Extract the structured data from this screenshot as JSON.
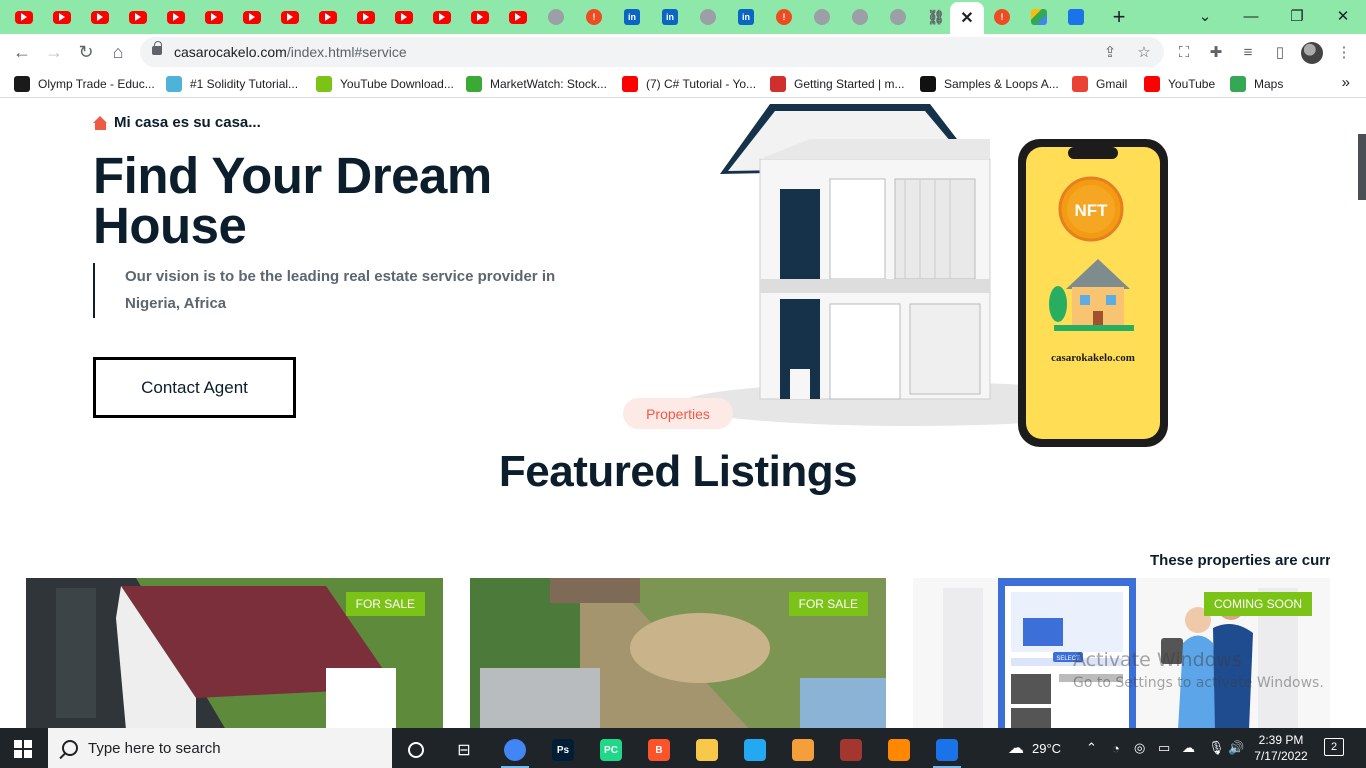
{
  "browser": {
    "tabs": [
      {
        "icon": "youtube-icon",
        "kind": "yt"
      },
      {
        "icon": "youtube-icon",
        "kind": "yt"
      },
      {
        "icon": "youtube-icon",
        "kind": "yt"
      },
      {
        "icon": "youtube-icon",
        "kind": "yt"
      },
      {
        "icon": "youtube-icon",
        "kind": "yt"
      },
      {
        "icon": "youtube-icon",
        "kind": "yt"
      },
      {
        "icon": "youtube-icon",
        "kind": "yt"
      },
      {
        "icon": "youtube-icon",
        "kind": "yt"
      },
      {
        "icon": "youtube-icon",
        "kind": "yt"
      },
      {
        "icon": "youtube-icon",
        "kind": "yt"
      },
      {
        "icon": "youtube-icon",
        "kind": "yt"
      },
      {
        "icon": "youtube-icon",
        "kind": "yt"
      },
      {
        "icon": "youtube-icon",
        "kind": "yt"
      },
      {
        "icon": "youtube-icon",
        "kind": "yt"
      },
      {
        "icon": "globe-icon",
        "kind": "glob"
      },
      {
        "icon": "warning-icon",
        "kind": "warn"
      },
      {
        "icon": "linkedin-icon",
        "kind": "li"
      },
      {
        "icon": "linkedin-icon",
        "kind": "li"
      },
      {
        "icon": "globe-icon",
        "kind": "glob"
      },
      {
        "icon": "linkedin-icon",
        "kind": "li"
      },
      {
        "icon": "warning-icon",
        "kind": "warn"
      },
      {
        "icon": "globe-icon",
        "kind": "glob"
      },
      {
        "icon": "globe-icon",
        "kind": "glob"
      },
      {
        "icon": "globe-icon",
        "kind": "glob"
      },
      {
        "icon": "link-icon",
        "kind": "link"
      }
    ],
    "active_tab_close": "✕",
    "extra_tabs": [
      {
        "icon": "warning-icon",
        "kind": "warn"
      },
      {
        "icon": "drive-icon",
        "kind": "drive"
      },
      {
        "icon": "screenshot-icon",
        "kind": "snap"
      }
    ],
    "new_tab": "+",
    "url_host": "casarocakelo.com",
    "url_path": "/index.html#service",
    "bookmarks": [
      {
        "label": "Olymp Trade - Educ...",
        "color": "#1a1a1a"
      },
      {
        "label": "#1 Solidity Tutorial...",
        "color": "#4fb3d9"
      },
      {
        "label": "YouTube Download...",
        "color": "#7cc317"
      },
      {
        "label": "MarketWatch: Stock...",
        "color": "#3aa935"
      },
      {
        "label": "(7) C# Tutorial - Yo...",
        "color": "#ff0000"
      },
      {
        "label": "Getting Started | m...",
        "color": "#d12e2e"
      },
      {
        "label": "Samples & Loops A...",
        "color": "#111111"
      },
      {
        "label": "Gmail",
        "color": "#ea4335"
      },
      {
        "label": "YouTube",
        "color": "#ff0000"
      },
      {
        "label": "Maps",
        "color": "#34a853"
      }
    ],
    "bookmarks_more": "»"
  },
  "hero": {
    "tagline": "Mi casa es su casa...",
    "title": "Find Your Dream House",
    "vision": "Our vision is to be the leading real estate service provider in Nigeria, Africa",
    "cta": "Contact Agent",
    "phone_badge": "NFT",
    "phone_site": "casarokakelo.com"
  },
  "listings": {
    "pill": "Properties",
    "heading": "Featured Listings",
    "subtext": "These properties are curre",
    "cards": [
      {
        "badge": "FOR SALE"
      },
      {
        "badge": "FOR SALE"
      },
      {
        "badge": "COMING SOON",
        "select_label": "SELECT"
      }
    ]
  },
  "watermark": {
    "line1": "Activate Windows",
    "line2": "Go to Settings to activate Windows."
  },
  "taskbar": {
    "search_placeholder": "Type here to search",
    "weather": "29°C",
    "time": "2:39 PM",
    "date": "7/17/2022",
    "notifications": "2",
    "apps": [
      {
        "name": "chrome-app",
        "label": "",
        "color": "#4285f4",
        "running": true
      },
      {
        "name": "photoshop-app",
        "label": "Ps",
        "color": "#001e36",
        "running": false
      },
      {
        "name": "pycharm-app",
        "label": "PC",
        "color": "#21d789",
        "running": false
      },
      {
        "name": "brave-app",
        "label": "B",
        "color": "#fb542b",
        "running": false
      },
      {
        "name": "file-explorer-app",
        "label": "",
        "color": "#f8c84a",
        "running": false
      },
      {
        "name": "vscode-app",
        "label": "",
        "color": "#23a9f2",
        "running": false
      },
      {
        "name": "media-player-app",
        "label": "",
        "color": "#f59f3a",
        "running": false
      },
      {
        "name": "winrar-app",
        "label": "",
        "color": "#a3362e",
        "running": false
      },
      {
        "name": "vlc-app",
        "label": "",
        "color": "#ff8800",
        "running": false
      },
      {
        "name": "snipping-tool-app",
        "label": "",
        "color": "#1a73e8",
        "running": true
      }
    ]
  },
  "colors": {
    "accent": "#ef5a44",
    "badge_green": "#7cc317",
    "navy": "#0c1d2b",
    "tabstrip": "#8ee8a9"
  }
}
